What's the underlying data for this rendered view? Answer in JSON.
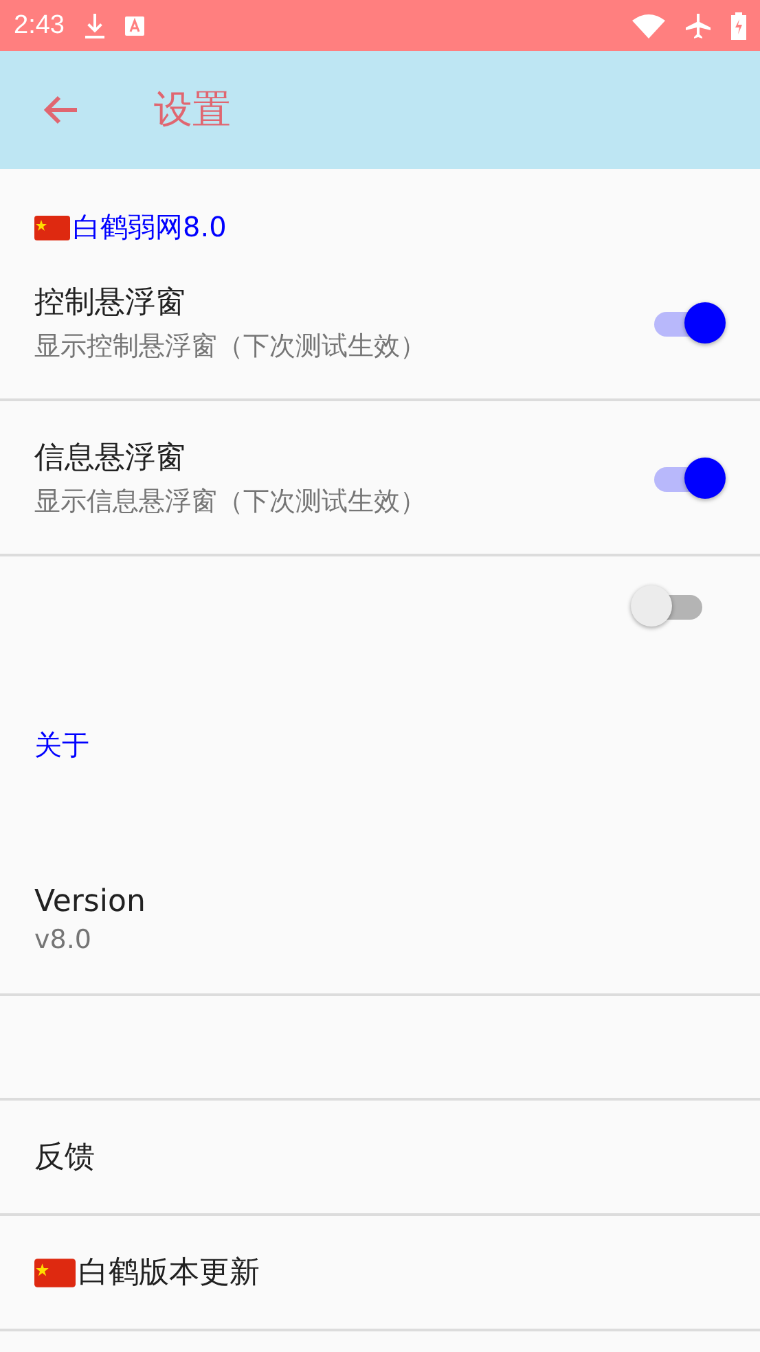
{
  "status_bar": {
    "time": "2:43"
  },
  "app_bar": {
    "title": "设置"
  },
  "items": [
    {
      "kind": "category",
      "title": "白鹤弱网8.0",
      "flag": true
    },
    {
      "kind": "switch",
      "title": "控制悬浮窗",
      "summary": "显示控制悬浮窗（下次测试生效）",
      "on": true
    },
    {
      "kind": "switch",
      "title": "信息悬浮窗",
      "summary": "显示信息悬浮窗（下次测试生效）",
      "on": true
    },
    {
      "kind": "bare_switch",
      "on": false
    },
    {
      "kind": "category",
      "title": "关于",
      "flag": false
    },
    {
      "kind": "info",
      "title": "Version",
      "summary": "v8.0"
    },
    {
      "kind": "blank"
    },
    {
      "kind": "link",
      "title": "反馈",
      "flag": false
    },
    {
      "kind": "link",
      "title": "白鹤版本更新",
      "flag": true
    }
  ]
}
